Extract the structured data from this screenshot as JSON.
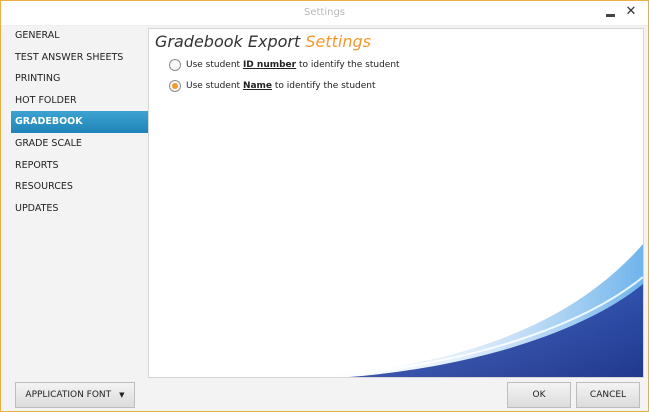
{
  "window": {
    "title": "Settings"
  },
  "sidebar": {
    "items": [
      {
        "label": "GENERAL"
      },
      {
        "label": "TEST ANSWER SHEETS"
      },
      {
        "label": "PRINTING"
      },
      {
        "label": "HOT FOLDER"
      },
      {
        "label": "GRADEBOOK",
        "active": true
      },
      {
        "label": "GRADE SCALE"
      },
      {
        "label": "REPORTS"
      },
      {
        "label": "RESOURCES"
      },
      {
        "label": "UPDATES"
      }
    ]
  },
  "main": {
    "heading_primary": "Gradebook Export",
    "heading_accent": "Settings",
    "options": [
      {
        "prefix": "Use student ",
        "keyword": "ID number",
        "suffix": " to identify the student",
        "checked": false
      },
      {
        "prefix": "Use student ",
        "keyword": "Name",
        "suffix": " to identify the student",
        "checked": true
      }
    ]
  },
  "footer": {
    "font_button": "APPLICATION FONT",
    "ok": "OK",
    "cancel": "CANCEL"
  },
  "colors": {
    "accent": "#f29a2e",
    "selection": "#2a91c5",
    "frame": "#e8b040",
    "swoosh": "#1f3d9e"
  },
  "icons": {
    "minimize": "minimize-icon",
    "close": "close-icon",
    "dropdown": "caret-down-icon"
  }
}
